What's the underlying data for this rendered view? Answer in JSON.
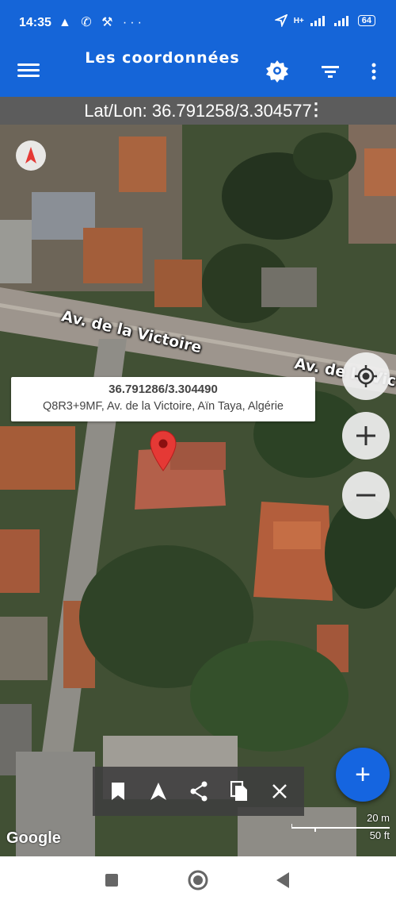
{
  "status_bar": {
    "time": "14:35",
    "notification_icons": "▲ ✆ ⚒ ···",
    "network_label": "H+",
    "battery": "64"
  },
  "app_bar": {
    "title": "Les coordonnées",
    "icons": [
      "menu-icon",
      "location-badge-icon",
      "filter-icon",
      "more-vert-icon"
    ]
  },
  "coord_bar": {
    "text": "Lat/Lon: 36.791258/3.304577"
  },
  "map": {
    "streets": [
      "Av. de la Victoire",
      "Av. de la Victoire"
    ],
    "info_window": {
      "coords": "36.791286/3.304490",
      "address": "Q8R3+9MF, Av. de la Victoire, Aïn Taya, Algérie"
    },
    "attribution": "Google",
    "scale": {
      "metric": "20 m",
      "imperial": "50 ft"
    }
  },
  "toolbar": {
    "icons": [
      "bookmark-icon",
      "navigate-icon",
      "share-icon",
      "copy-icon",
      "close-icon"
    ]
  },
  "fab": {
    "label": "+"
  },
  "colors": {
    "primary": "#1565d8",
    "coord_bar": "#5c5c5c",
    "pin": "#e53935",
    "fab": "#1565e0"
  }
}
